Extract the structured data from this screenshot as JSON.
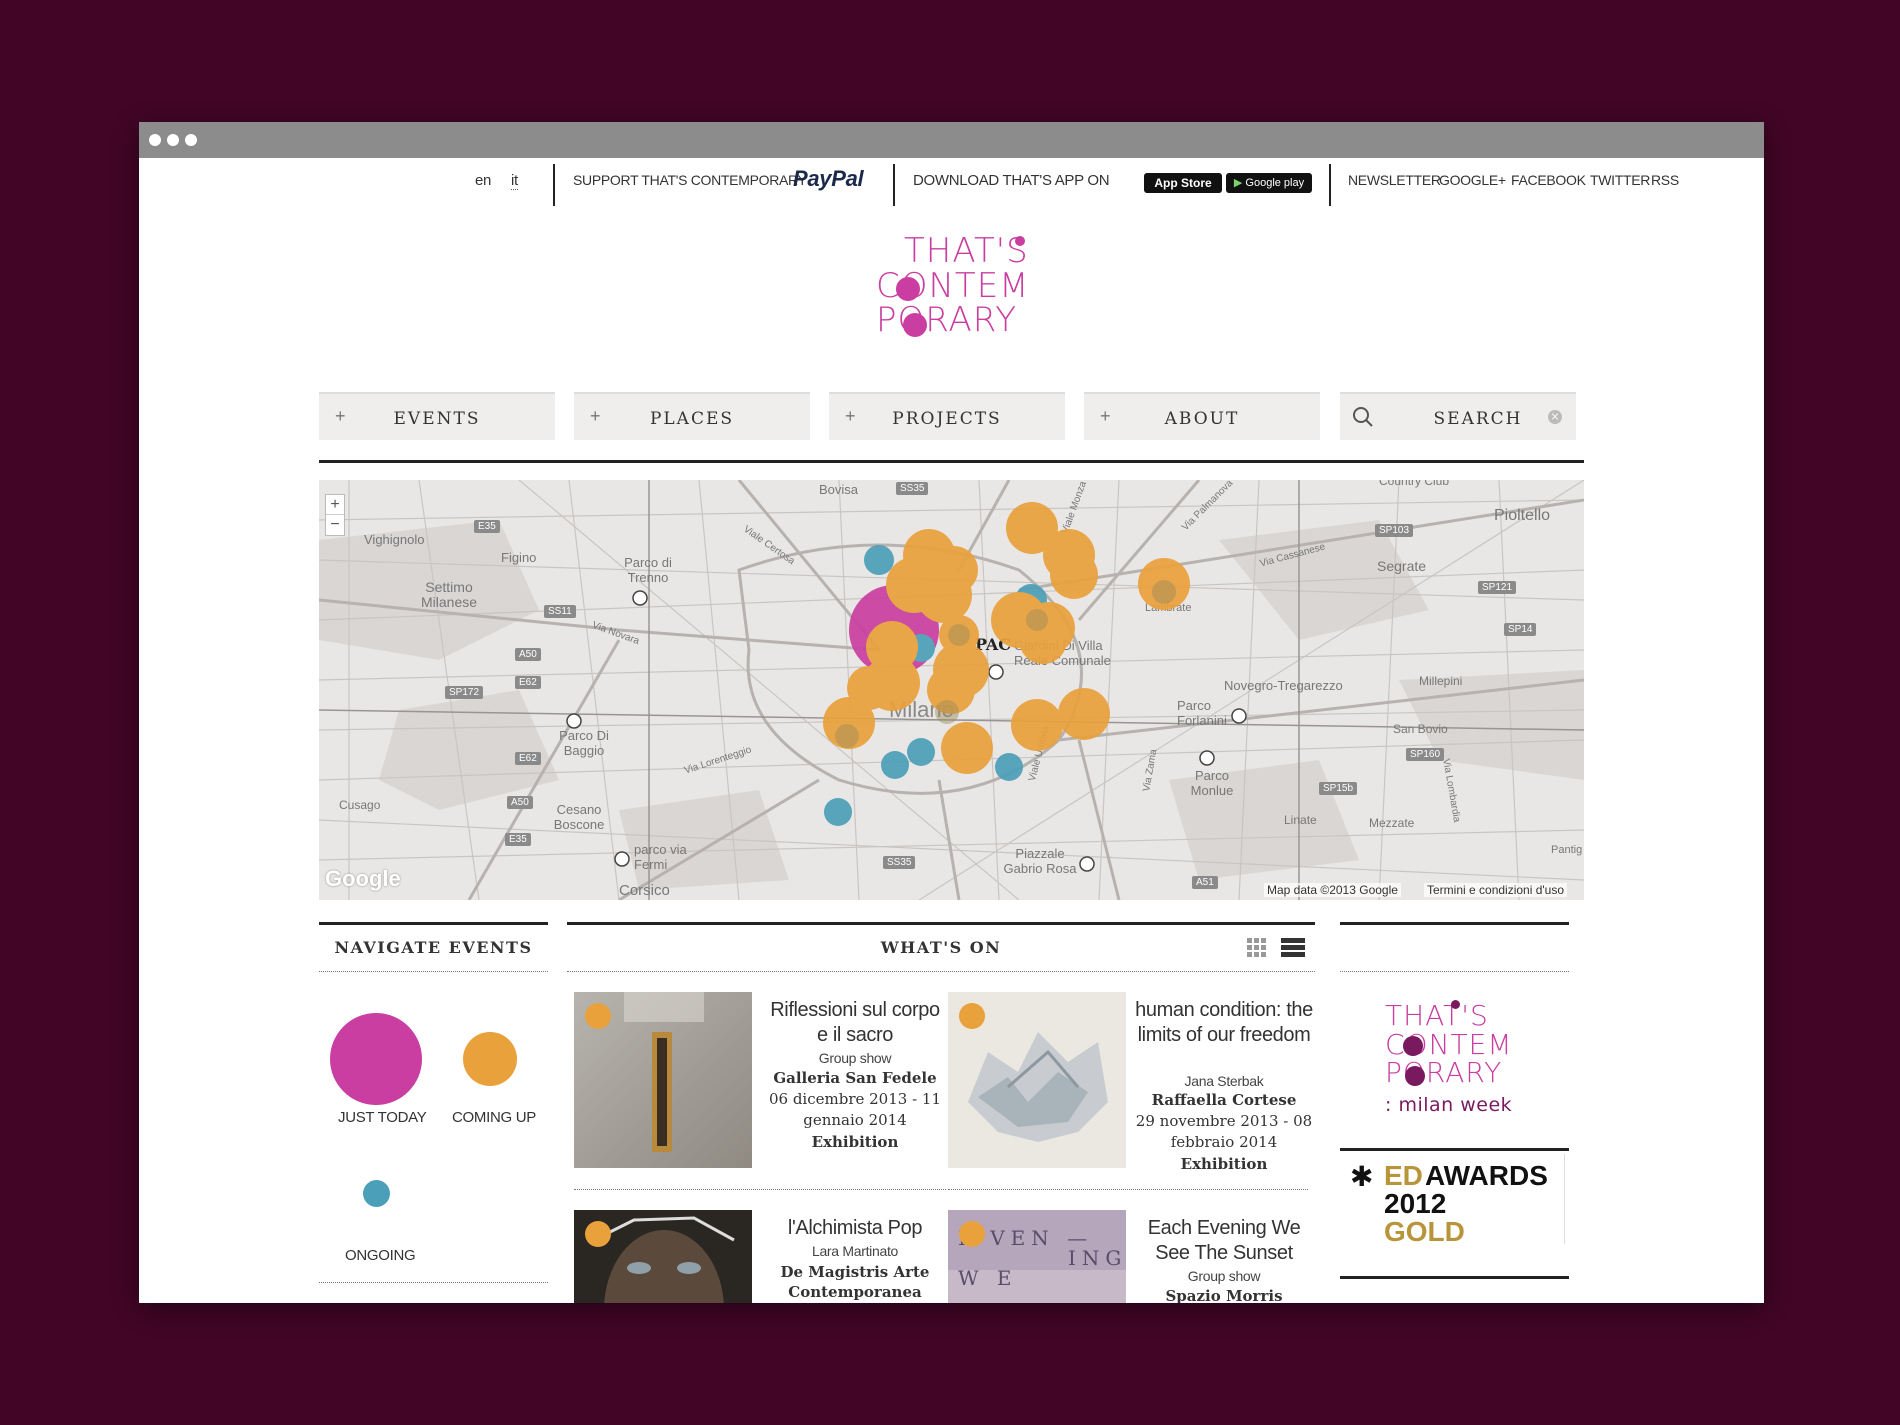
{
  "lang": {
    "en": "en",
    "it": "it"
  },
  "topbar": {
    "support": "SUPPORT THAT'S CONTEMPORARY",
    "paypal": "PayPal",
    "download": "DOWNLOAD THAT'S APP ON",
    "appstore": "App Store",
    "googleplay": "Google play",
    "links": [
      "NEWSLETTER",
      "GOOGLE+",
      "FACEBOOK",
      "TWITTER",
      "RSS"
    ]
  },
  "logo": {
    "line1": "THAT'S",
    "line2": "CONTEM",
    "line3": "PORARY"
  },
  "menu": {
    "events": "EVENTS",
    "places": "PLACES",
    "projects": "PROJECTS",
    "about": "ABOUT",
    "search": "SEARCH",
    "plus": "+"
  },
  "map": {
    "attribution": "Map data ©2013 Google",
    "terms": "Termini e condizioni d'uso",
    "google": "Google",
    "zoom_in": "+",
    "zoom_out": "−",
    "labels": [
      "Bovisa",
      "Vighignolo",
      "Figino",
      "Parco di Trenno",
      "Settimo Milanese",
      "Pioltello",
      "Segrate",
      "Country Club",
      "Lambrate",
      "Parco Di Baggio",
      "Novegro-Tregarezzo",
      "Millepini",
      "Parco Forlanini",
      "San Bovio",
      "Parco Monlue",
      "Cusago",
      "Cesano Boscone",
      "Linate",
      "Mezzate",
      "parco via Fermi",
      "Corsico",
      "Piazzale Gabrio Rosa",
      "Milano",
      "Giardini Di Villa Reale Comunale",
      "PAC",
      "Pantig",
      "Viale Certosa",
      "Via Novara",
      "Via Lorenteggio",
      "Via Cassanese",
      "Viale Monza",
      "Via Palmanova",
      "Viale Umbria",
      "Via Zama",
      "Via Lombardia"
    ],
    "roads": [
      "SS35",
      "E35",
      "SS11",
      "A50",
      "E62",
      "SP172",
      "SP103",
      "SP121",
      "SP14",
      "SP160",
      "SP15b",
      "A51",
      "SS35",
      "A50",
      "E35",
      "E62"
    ]
  },
  "colors": {
    "just_today": "#c93ea0",
    "coming_up": "#e9a13b",
    "ongoing": "#4b9fb8",
    "brand": "#c93ea0"
  },
  "navigate": {
    "title": "NAVIGATE EVENTS",
    "legend": [
      {
        "label": "JUST TODAY",
        "color": "#c93ea0"
      },
      {
        "label": "COMING UP",
        "color": "#e9a13b"
      },
      {
        "label": "ONGOING",
        "color": "#4b9fb8"
      }
    ]
  },
  "whats_on": {
    "title": "WHAT'S ON",
    "icons": [
      "grid-view-icon",
      "list-view-icon"
    ],
    "events": [
      {
        "title": "Riflessioni sul corpo e il sacro",
        "artist": "Group show",
        "venue": "Galleria San Fedele",
        "dates": "06 dicembre 2013 - 11 gennaio 2014",
        "type": "Exhibition"
      },
      {
        "title": "human condition: the limits of our freedom",
        "artist": "Jana Sterbak",
        "venue": "Raffaella Cortese",
        "dates": "29 novembre 2013 - 08 febbraio 2014",
        "type": "Exhibition"
      },
      {
        "title": "l'Alchimista Pop",
        "artist": "Lara Martinato",
        "venue": "De Magistris Arte Contemporanea",
        "dates": "",
        "type": ""
      },
      {
        "title": "Each Evening We See The Sunset",
        "artist": "Group show",
        "venue": "Spazio Morris",
        "dates": "",
        "type": ""
      }
    ]
  },
  "sidebar": {
    "week_logo": {
      "line1": "THAT'S",
      "line2": "CONTEM",
      "line3": "PORARY",
      "sub": ": milan week"
    },
    "award": {
      "star": "✱",
      "ed": "ED",
      "awards": "AWARDS",
      "year": "2012",
      "gold": "GOLD"
    }
  }
}
